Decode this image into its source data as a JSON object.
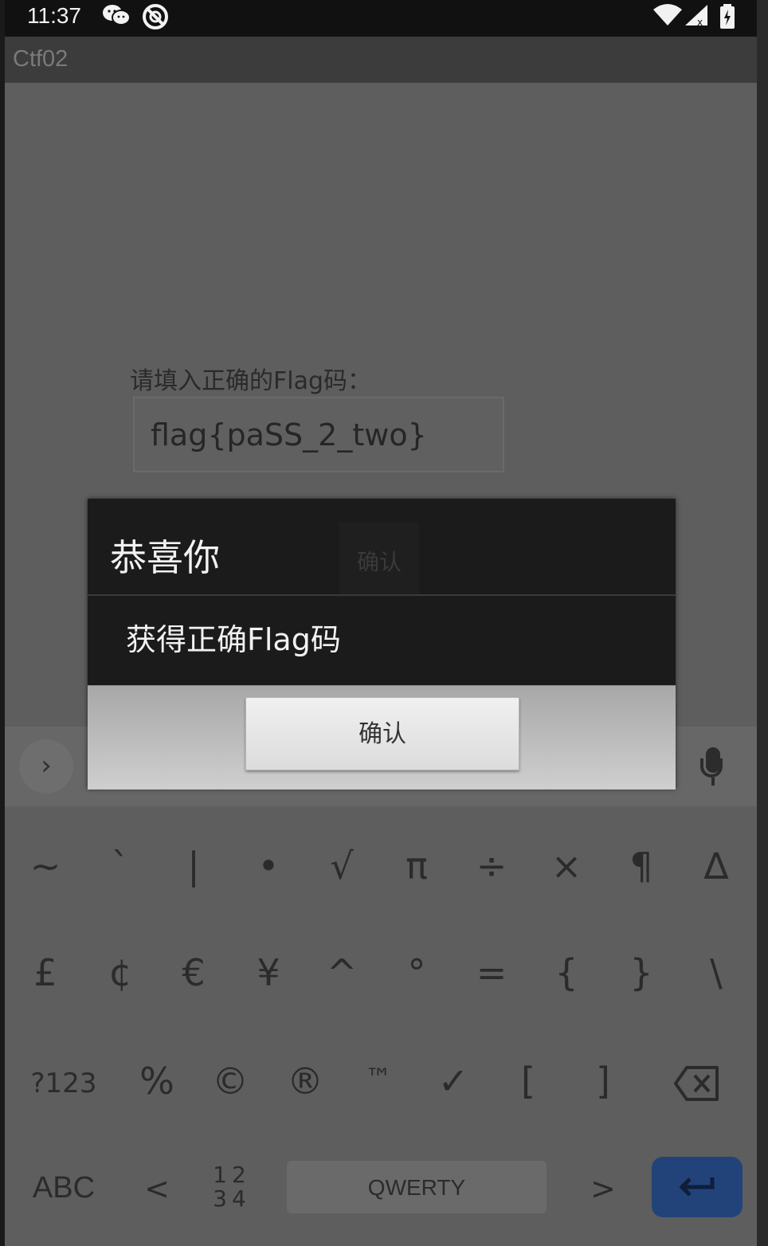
{
  "status_bar": {
    "time": "11:37",
    "icons": [
      "wechat-icon",
      "dnd-icon",
      "wifi-icon",
      "signal-icon",
      "battery-icon"
    ]
  },
  "app": {
    "title": "Ctf02",
    "prompt_label": "请填入正确的Flag码：",
    "flag_value": "flag{paSS_2_two}",
    "background_button_label": "确认"
  },
  "dialog": {
    "title": "恭喜你",
    "message": "获得正确Flag码",
    "confirm_label": "确认"
  },
  "keyboard": {
    "row1": [
      "~",
      "`",
      "|",
      "•",
      "√",
      "π",
      "÷",
      "×",
      "¶",
      "∆"
    ],
    "row2": [
      "£",
      "¢",
      "€",
      "¥",
      "^",
      "°",
      "=",
      "{",
      "}",
      "\\"
    ],
    "row3": [
      "?123",
      "%",
      "©",
      "®",
      "™",
      "✓",
      "[",
      "]"
    ],
    "row4": {
      "abc": "ABC",
      "lt": "<",
      "nums_top": "12",
      "nums_bottom": "34",
      "space": "QWERTY",
      "gt": ">"
    },
    "enter_color": "#22437a"
  }
}
